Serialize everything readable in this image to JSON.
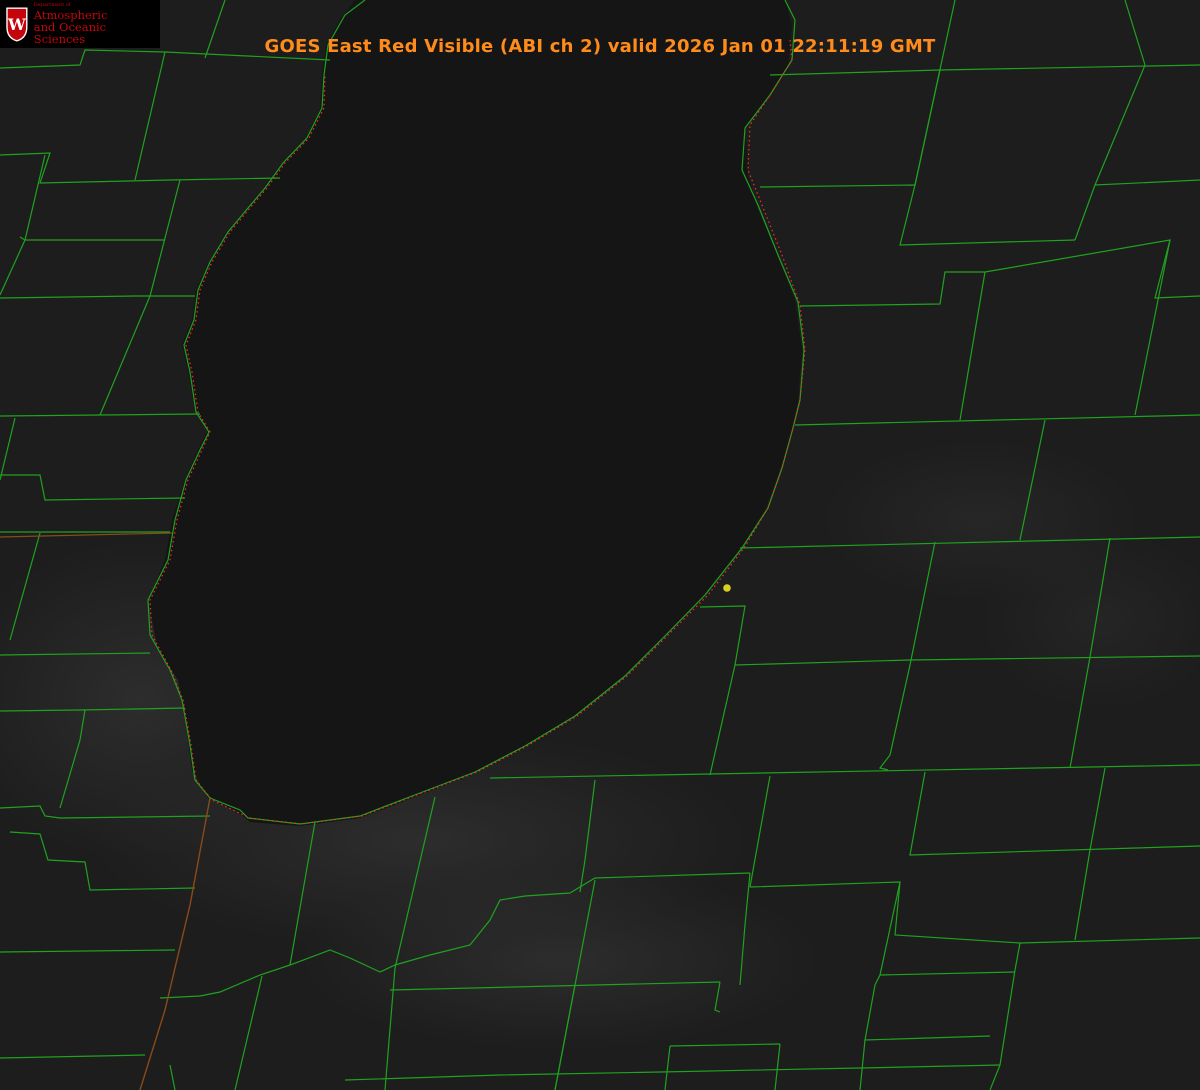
{
  "logo": {
    "department": "Department of",
    "line1": "Atmospheric",
    "line2": "and Oceanic Sciences",
    "crest_letter": "W",
    "crest_color": "#c5050c"
  },
  "title": "GOES East Red Visible (ABI ch 2) valid 2026 Jan 01 22:11:19 GMT",
  "colors": {
    "background": "#1b1b1b",
    "lake": "#161616",
    "county_lines": "#1fa21f",
    "state_line": "#8a4a1a",
    "shoreline_dots": "#ff2a2a",
    "station_marker": "#d8d020",
    "title_text": "#ff8c1a"
  }
}
